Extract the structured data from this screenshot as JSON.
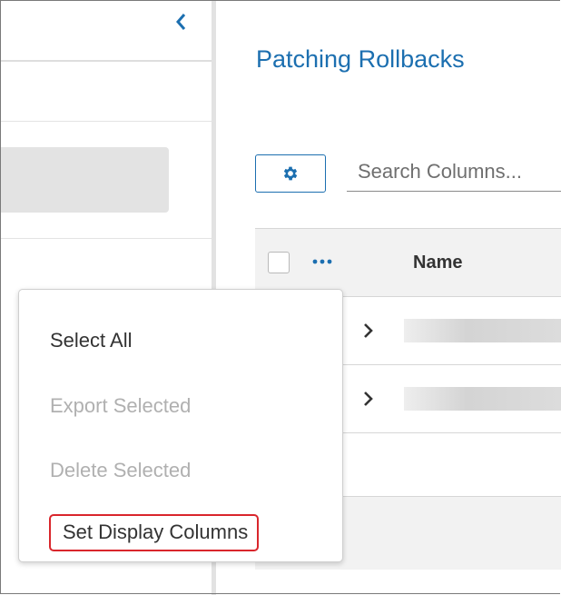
{
  "page": {
    "title": "Patching Rollbacks"
  },
  "toolbar": {
    "settings_icon": "gear-icon",
    "search_placeholder": "Search Columns..."
  },
  "table": {
    "columns": [
      "Name"
    ],
    "header_menu_icon": "more-horizontal-icon",
    "rows": [
      {
        "expand_icon": "chevron-right-icon"
      },
      {
        "expand_icon": "chevron-right-icon"
      }
    ]
  },
  "sidebar": {
    "collapse_icon": "chevron-left-icon"
  },
  "context_menu": {
    "items": [
      {
        "label": "Select All",
        "enabled": true
      },
      {
        "label": "Export Selected",
        "enabled": false
      },
      {
        "label": "Delete Selected",
        "enabled": false
      },
      {
        "label": "Set Display Columns",
        "enabled": true,
        "highlighted": true
      }
    ]
  },
  "colors": {
    "accent": "#1c6fb0",
    "highlight_border": "#d9262c",
    "disabled_text": "#b0b0b0"
  }
}
